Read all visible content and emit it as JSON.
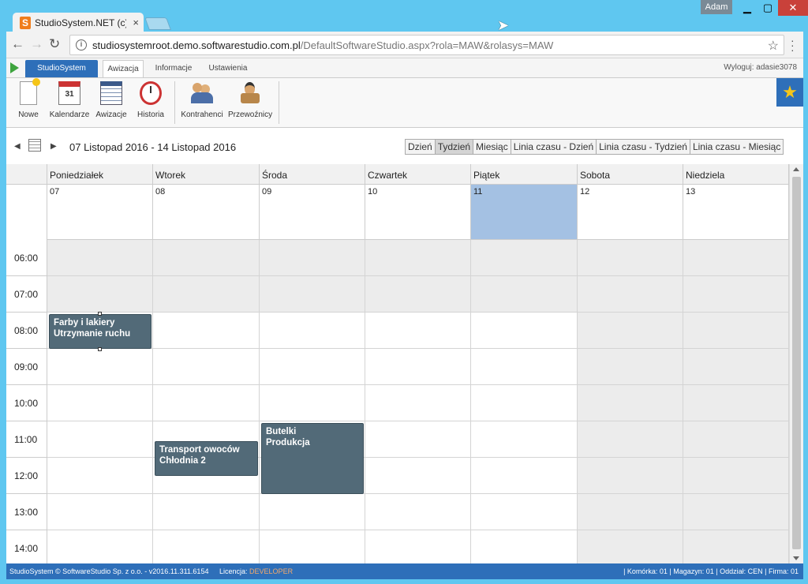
{
  "browser": {
    "tab_title": "StudioSystem.NET (c) So",
    "tab_close": "×",
    "user": "Adam",
    "url_host": "studiosystemroot.demo.softwarestudio.com.pl",
    "url_path": "/DefaultSoftwareStudio.aspx?rola=MAW&rolasys=MAW"
  },
  "app": {
    "brand_tab": "StudioSystem",
    "tabs": [
      {
        "label": "Awizacja"
      },
      {
        "label": "Informacje"
      },
      {
        "label": "Ustawienia"
      }
    ],
    "logout": "Wyloguj: adasie3078",
    "ribbon": [
      {
        "label": "Nowe",
        "icon": "new-document-icon"
      },
      {
        "label": "Kalendarze",
        "icon": "calendar-icon"
      },
      {
        "label": "Awizacje",
        "icon": "schedule-grid-icon"
      },
      {
        "label": "Historia",
        "icon": "history-clock-icon"
      },
      {
        "label": "Kontrahenci",
        "icon": "contractors-icon"
      },
      {
        "label": "Przewoźnicy",
        "icon": "carriers-icon"
      }
    ],
    "calendar_day_number": "31"
  },
  "calendar": {
    "range": "07 Listopad 2016 - 14 Listopad 2016",
    "views": [
      "Dzień",
      "Tydzień",
      "Miesiąc",
      "Linia czasu - Dzień",
      "Linia czasu - Tydzień",
      "Linia czasu - Miesiąc"
    ],
    "active_view": "Tydzień",
    "days": [
      {
        "name": "Poniedziałek",
        "date": "07"
      },
      {
        "name": "Wtorek",
        "date": "08"
      },
      {
        "name": "Środa",
        "date": "09"
      },
      {
        "name": "Czwartek",
        "date": "10"
      },
      {
        "name": "Piątek",
        "date": "11"
      },
      {
        "name": "Sobota",
        "date": "12"
      },
      {
        "name": "Niedziela",
        "date": "13"
      }
    ],
    "today_index": 4,
    "hours": [
      "06:00",
      "07:00",
      "08:00",
      "09:00",
      "10:00",
      "11:00",
      "12:00",
      "13:00",
      "14:00"
    ],
    "events": [
      {
        "day": 0,
        "start": "08:00",
        "end": "09:00",
        "line1": "Farby i lakiery",
        "line2": "Utrzymanie ruchu"
      },
      {
        "day": 1,
        "start": "11:30",
        "end": "12:30",
        "line1": "Transport owoców",
        "line2": "Chłodnia 2"
      },
      {
        "day": 2,
        "start": "11:00",
        "end": "13:00",
        "line1": "Butelki",
        "line2": "Produkcja"
      }
    ],
    "colors": {
      "event": "#526a78",
      "today": "#a4c1e3",
      "off_hours": "#ececec",
      "brand": "#2e6fb9"
    }
  },
  "footer": {
    "copyright": "StudioSystem © SoftwareStudio Sp. z o.o. - v2016.11.311.6154",
    "license_label": "Licencja:",
    "license_value": "DEVELOPER",
    "status": "| Komórka: 01 | Magazyn: 01 | Oddział: CEN | Firma: 01"
  }
}
